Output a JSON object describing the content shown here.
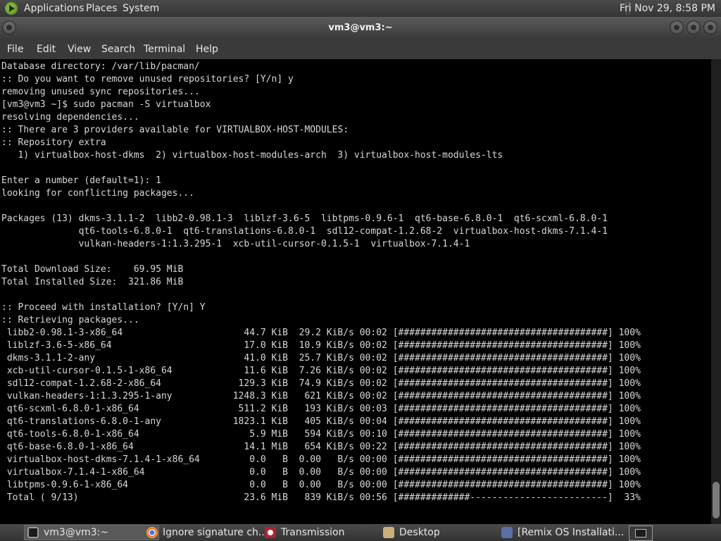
{
  "top_panel": {
    "menus": [
      "Applications",
      "Places",
      "System"
    ],
    "clock": "Fri Nov 29,  8:58 PM"
  },
  "window": {
    "title": "vm3@vm3:~"
  },
  "menubar": {
    "items": [
      "File",
      "Edit",
      "View",
      "Search",
      "Terminal",
      "Help"
    ]
  },
  "terminal": {
    "lines": [
      "Database directory: /var/lib/pacman/",
      ":: Do you want to remove unused repositories? [Y/n] y",
      "removing unused sync repositories...",
      "[vm3@vm3 ~]$ sudo pacman -S virtualbox",
      "resolving dependencies...",
      ":: There are 3 providers available for VIRTUALBOX-HOST-MODULES:",
      ":: Repository extra",
      "   1) virtualbox-host-dkms  2) virtualbox-host-modules-arch  3) virtualbox-host-modules-lts",
      "",
      "Enter a number (default=1): 1",
      "looking for conflicting packages...",
      "",
      "Packages (13) dkms-3.1.1-2  libb2-0.98.1-3  liblzf-3.6-5  libtpms-0.9.6-1  qt6-base-6.8.0-1  qt6-scxml-6.8.0-1",
      "              qt6-tools-6.8.0-1  qt6-translations-6.8.0-1  sdl12-compat-1.2.68-2  virtualbox-host-dkms-7.1.4-1",
      "              vulkan-headers-1:1.3.295-1  xcb-util-cursor-0.1.5-1  virtualbox-7.1.4-1",
      "",
      "Total Download Size:    69.95 MiB",
      "Total Installed Size:  321.86 MiB",
      "",
      ":: Proceed with installation? [Y/n] Y",
      ":: Retrieving packages...",
      " libb2-0.98.1-3-x86_64                      44.7 KiB  29.2 KiB/s 00:02 [######################################] 100%",
      " liblzf-3.6-5-x86_64                        17.0 KiB  10.9 KiB/s 00:02 [######################################] 100%",
      " dkms-3.1.1-2-any                           41.0 KiB  25.7 KiB/s 00:02 [######################################] 100%",
      " xcb-util-cursor-0.1.5-1-x86_64             11.6 KiB  7.26 KiB/s 00:02 [######################################] 100%",
      " sdl12-compat-1.2.68-2-x86_64              129.3 KiB  74.9 KiB/s 00:02 [######################################] 100%",
      " vulkan-headers-1:1.3.295-1-any           1248.3 KiB   621 KiB/s 00:02 [######################################] 100%",
      " qt6-scxml-6.8.0-1-x86_64                  511.2 KiB   193 KiB/s 00:03 [######################################] 100%",
      " qt6-translations-6.8.0-1-any             1823.1 KiB   405 KiB/s 00:04 [######################################] 100%",
      " qt6-tools-6.8.0-1-x86_64                    5.9 MiB   594 KiB/s 00:10 [######################################] 100%",
      " qt6-base-6.8.0-1-x86_64                    14.1 MiB   654 KiB/s 00:22 [######################################] 100%",
      " virtualbox-host-dkms-7.1.4-1-x86_64         0.0   B  0.00   B/s 00:00 [######################################] 100%",
      " virtualbox-7.1.4-1-x86_64                   0.0   B  0.00   B/s 00:00 [######################################] 100%",
      " libtpms-0.9.6-1-x86_64                      0.0   B  0.00   B/s 00:00 [######################################] 100%",
      " Total ( 9/13)                              23.6 MiB   839 KiB/s 00:56 [#############-------------------------]  33%"
    ]
  },
  "taskbar": {
    "tasks": [
      "vm3@vm3:~",
      "Ignore signature ch...",
      "Transmission",
      "Desktop",
      "[Remix OS Installati..."
    ]
  }
}
